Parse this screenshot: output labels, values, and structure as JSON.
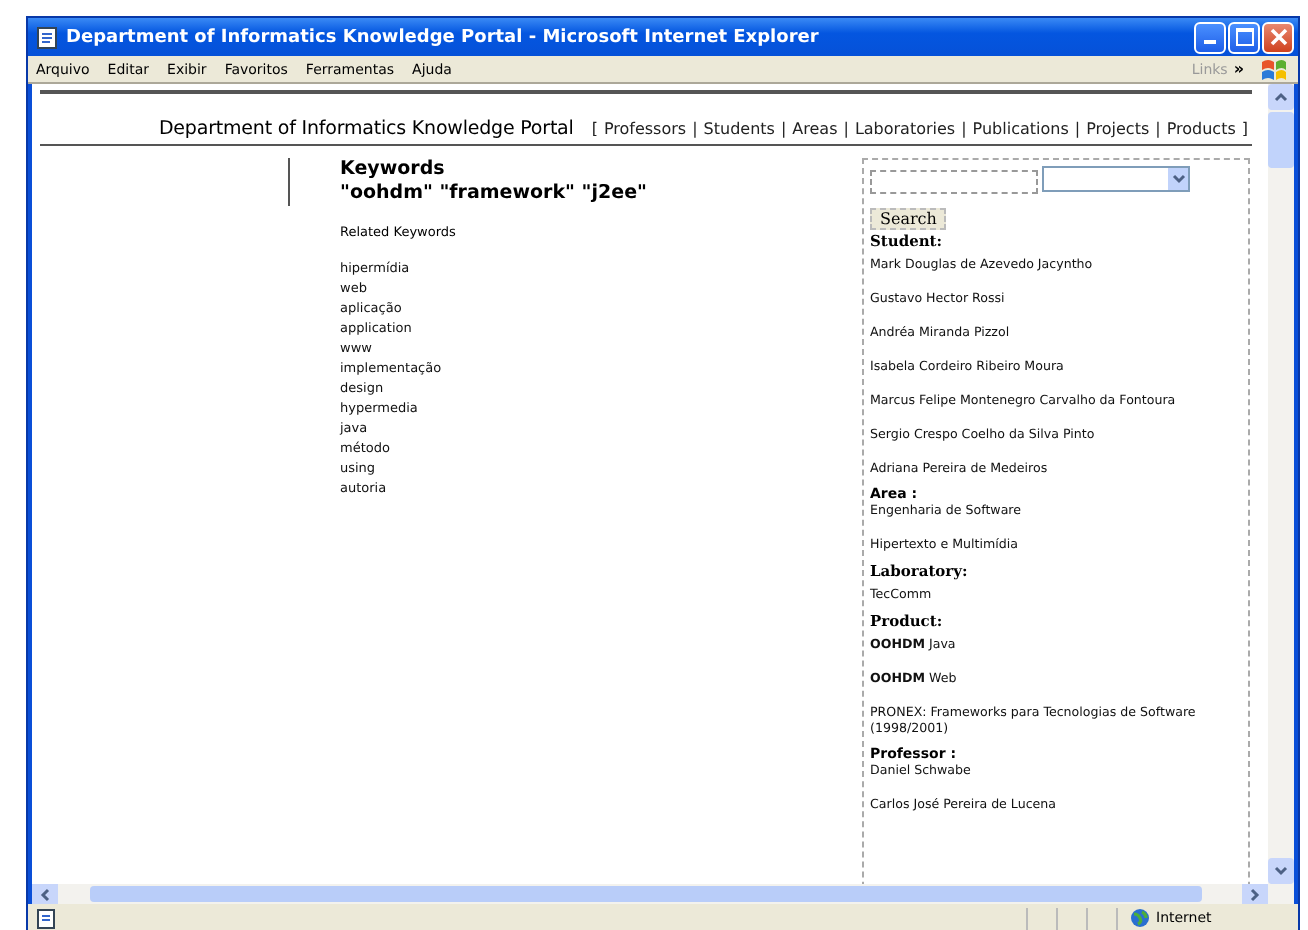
{
  "window": {
    "title": "Department of Informatics Knowledge Portal - Microsoft Internet Explorer"
  },
  "menu": [
    "Arquivo",
    "Editar",
    "Exibir",
    "Favoritos",
    "Ferramentas",
    "Ajuda"
  ],
  "links_label": "Links",
  "links_chevron": "»",
  "header": {
    "title": "Department of Informatics Knowledge Portal",
    "open_bracket": "[",
    "close_bracket": "]",
    "separator": "|",
    "nav": [
      "Professors",
      "Students",
      "Areas",
      "Laboratories",
      "Publications",
      "Projects",
      "Products"
    ]
  },
  "keywords": {
    "title": "Keywords",
    "query": "\"oohdm\" \"framework\" \"j2ee\"",
    "related_label": "Related Keywords",
    "items": [
      "hipermídia",
      "web",
      "aplicação",
      "application",
      "www",
      "implementação",
      "design",
      "hypermedia",
      "java",
      "método",
      "using",
      "autoria"
    ]
  },
  "search": {
    "button": "Search"
  },
  "sections": [
    {
      "heading": "Student:",
      "kind": "serif",
      "items": [
        "Mark Douglas de Azevedo Jacyntho",
        "Gustavo Hector Rossi",
        "Andréa Miranda Pizzol",
        "Isabela Cordeiro Ribeiro Moura",
        "Marcus Felipe Montenegro Carvalho da Fontoura",
        "Sergio Crespo Coelho da Silva Pinto",
        "Adriana Pereira de Medeiros"
      ]
    },
    {
      "heading": "Area :",
      "kind": "sans",
      "items": [
        "Engenharia de Software",
        "Hipertexto e Multimídia"
      ]
    },
    {
      "heading": "Laboratory:",
      "kind": "serif",
      "items": [
        "TecComm"
      ]
    },
    {
      "heading": "Product:",
      "kind": "serif",
      "items": [
        "**OOHDM** Java",
        "**OOHDM** Web",
        "PRONEX: Frameworks para Tecnologias de Software (1998/2001)"
      ]
    },
    {
      "heading": "Professor :",
      "kind": "sans",
      "items": [
        "Daniel Schwabe",
        "Carlos José Pereira de Lucena"
      ]
    }
  ],
  "status_bar": {
    "zone": "Internet"
  }
}
